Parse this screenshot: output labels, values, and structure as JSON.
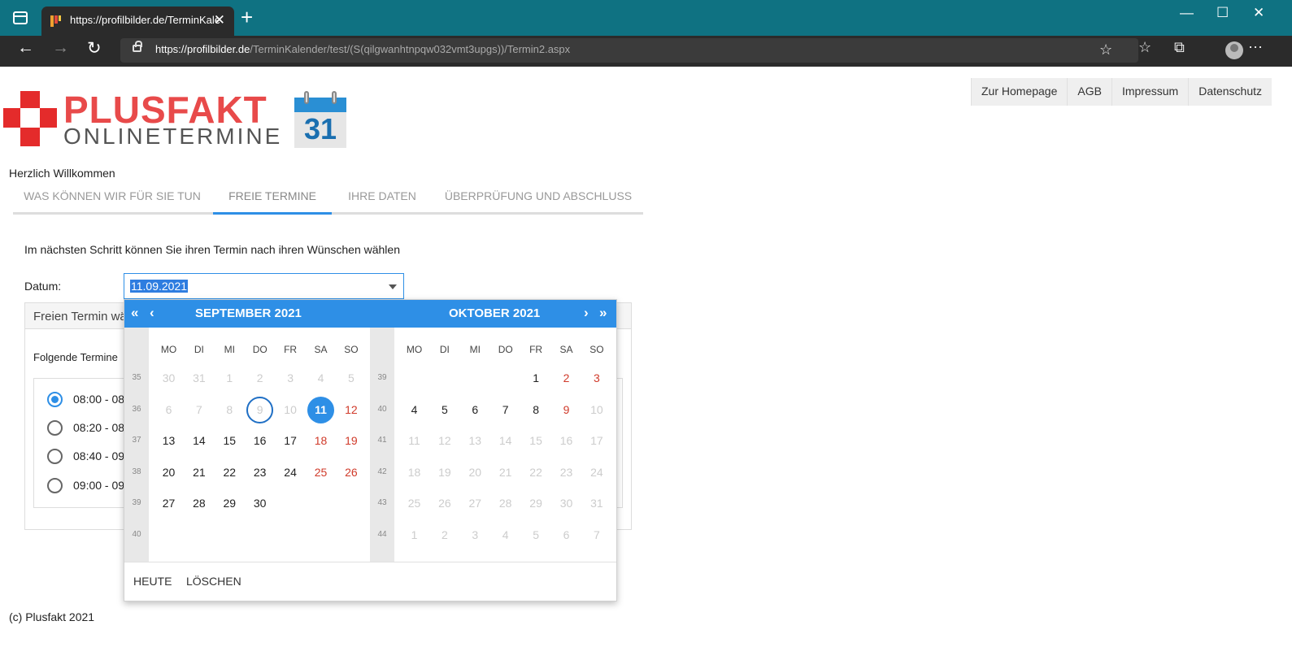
{
  "browser": {
    "tab_title": "https://profilbilder.de/TerminKale",
    "url_host": "https://profilbilder.de",
    "url_path": "/TerminKalender/test/(S(qilgwanhtnpqw032vmt3upgs))/Termin2.aspx"
  },
  "logo": {
    "line1": "PLUSFAKT",
    "line2": "ONLINETERMINE",
    "calendar_number": "31"
  },
  "topnav": [
    "Zur Homepage",
    "AGB",
    "Impressum",
    "Datenschutz"
  ],
  "welcome": "Herzlich Willkommen",
  "steps": [
    "WAS KÖNNEN WIR FÜR SIE TUN",
    "FREIE TERMINE",
    "IHRE DATEN",
    "ÜBERPRÜFUNG UND ABSCHLUSS"
  ],
  "active_step": "FREIE TERMINE",
  "intro": "Im nächsten Schritt können Sie ihren Termin nach ihren Wünschen wählen",
  "date_field": {
    "label": "Datum:",
    "value": "11.09.2021"
  },
  "panel": {
    "title": "Freien Termin wä",
    "subtitle": "Folgende Termine",
    "slots": [
      {
        "label": "08:00 - 08:",
        "selected": true
      },
      {
        "label": "08:20 - 08:",
        "selected": false
      },
      {
        "label": "08:40 - 09:",
        "selected": false
      },
      {
        "label": "09:00 - 09:",
        "selected": false
      }
    ]
  },
  "footer": "(c) Plusfakt 2021",
  "calendar": {
    "weekdays": [
      "MO",
      "DI",
      "MI",
      "DO",
      "FR",
      "SA",
      "SO"
    ],
    "months": [
      {
        "title": "SEPTEMBER 2021",
        "weeks": [
          {
            "kw": "35",
            "days": [
              {
                "d": "30",
                "m": 1
              },
              {
                "d": "31",
                "m": 1
              },
              {
                "d": "1"
              },
              {
                "d": "2"
              },
              {
                "d": "3"
              },
              {
                "d": "4"
              },
              {
                "d": "5"
              }
            ]
          },
          {
            "kw": "36",
            "days": [
              {
                "d": "6"
              },
              {
                "d": "7"
              },
              {
                "d": "8"
              },
              {
                "d": "9",
                "today": 1
              },
              {
                "d": "10"
              },
              {
                "d": "11",
                "sel": 1
              },
              {
                "d": "12",
                "we": 1
              }
            ]
          },
          {
            "kw": "37",
            "days": [
              {
                "d": "13",
                "a": 1
              },
              {
                "d": "14",
                "a": 1
              },
              {
                "d": "15",
                "a": 1
              },
              {
                "d": "16",
                "a": 1
              },
              {
                "d": "17",
                "a": 1
              },
              {
                "d": "18",
                "we": 1
              },
              {
                "d": "19",
                "we": 1
              }
            ]
          },
          {
            "kw": "38",
            "days": [
              {
                "d": "20",
                "a": 1
              },
              {
                "d": "21",
                "a": 1
              },
              {
                "d": "22",
                "a": 1
              },
              {
                "d": "23",
                "a": 1
              },
              {
                "d": "24",
                "a": 1
              },
              {
                "d": "25",
                "we": 1
              },
              {
                "d": "26",
                "we": 1
              }
            ]
          },
          {
            "kw": "39",
            "days": [
              {
                "d": "27",
                "a": 1
              },
              {
                "d": "28",
                "a": 1
              },
              {
                "d": "29",
                "a": 1
              },
              {
                "d": "30",
                "a": 1
              }
            ]
          },
          {
            "kw": "40",
            "days": []
          }
        ]
      },
      {
        "title": "OKTOBER 2021",
        "weeks": [
          {
            "kw": "39",
            "days": [
              {
                "d": ""
              },
              {
                "d": ""
              },
              {
                "d": ""
              },
              {
                "d": ""
              },
              {
                "d": "1",
                "a": 1
              },
              {
                "d": "2",
                "we": 1
              },
              {
                "d": "3",
                "we": 1
              }
            ]
          },
          {
            "kw": "40",
            "days": [
              {
                "d": "4",
                "a": 1
              },
              {
                "d": "5",
                "a": 1
              },
              {
                "d": "6",
                "a": 1
              },
              {
                "d": "7",
                "a": 1
              },
              {
                "d": "8",
                "a": 1
              },
              {
                "d": "9",
                "we": 1
              },
              {
                "d": "10"
              }
            ]
          },
          {
            "kw": "41",
            "days": [
              {
                "d": "11"
              },
              {
                "d": "12"
              },
              {
                "d": "13"
              },
              {
                "d": "14"
              },
              {
                "d": "15"
              },
              {
                "d": "16"
              },
              {
                "d": "17"
              }
            ]
          },
          {
            "kw": "42",
            "days": [
              {
                "d": "18"
              },
              {
                "d": "19"
              },
              {
                "d": "20"
              },
              {
                "d": "21"
              },
              {
                "d": "22"
              },
              {
                "d": "23"
              },
              {
                "d": "24"
              }
            ]
          },
          {
            "kw": "43",
            "days": [
              {
                "d": "25"
              },
              {
                "d": "26"
              },
              {
                "d": "27"
              },
              {
                "d": "28"
              },
              {
                "d": "29"
              },
              {
                "d": "30"
              },
              {
                "d": "31"
              }
            ]
          },
          {
            "kw": "44",
            "days": [
              {
                "d": "1",
                "m": 1
              },
              {
                "d": "2",
                "m": 1
              },
              {
                "d": "3",
                "m": 1
              },
              {
                "d": "4",
                "m": 1
              },
              {
                "d": "5",
                "m": 1
              },
              {
                "d": "6",
                "m": 1
              },
              {
                "d": "7",
                "m": 1
              }
            ]
          }
        ]
      }
    ],
    "buttons": {
      "today": "HEUTE",
      "clear": "LÖSCHEN"
    }
  },
  "colors": {
    "accent": "#2e8fe6",
    "weekend": "#d03a2a",
    "muted": "#cccccc",
    "logo_red": "#e42b2b"
  }
}
